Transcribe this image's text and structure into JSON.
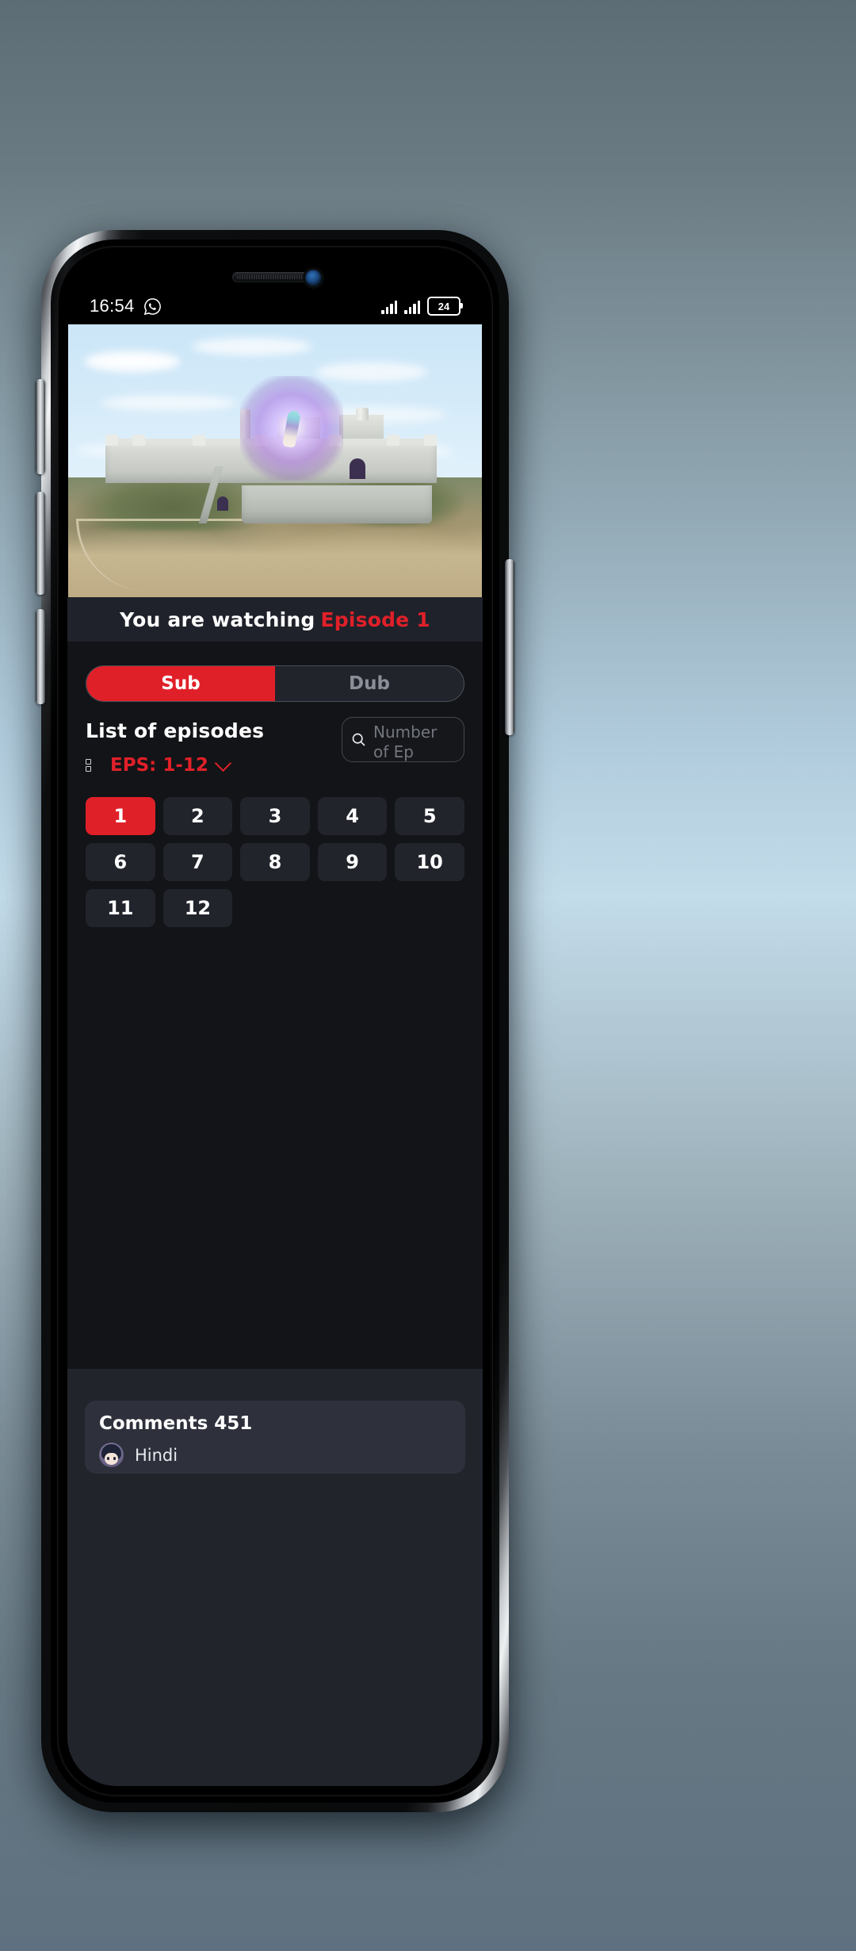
{
  "statusbar": {
    "time": "16:54",
    "whatsapp_icon": "whatsapp-icon",
    "signal_icon": "signal-bars-icon",
    "battery_level": "24"
  },
  "player": {
    "name": "video-player",
    "scene_description": "anime castle fortress on rocky hill with glowing purple aura"
  },
  "watching": {
    "prefix": "You are watching",
    "episode": "Episode 1",
    "accent_color": "#e02029"
  },
  "toggle": {
    "sub_label": "Sub",
    "dub_label": "Dub",
    "active": "Sub"
  },
  "episodes_header": {
    "title": "List of episodes",
    "range_label": "EPS: 1-12",
    "list_icon": "list-icon",
    "chevron_icon": "chevron-down-icon"
  },
  "search": {
    "placeholder": "Number of Ep",
    "value": "",
    "icon": "search-icon"
  },
  "episodes": {
    "items": [
      "1",
      "2",
      "3",
      "4",
      "5",
      "6",
      "7",
      "8",
      "9",
      "10",
      "11",
      "12"
    ],
    "selected": "1",
    "selected_color": "#e02029"
  },
  "comments": {
    "title": "Comments 451",
    "count": "451",
    "user": "Hindi",
    "avatar_icon": "avatar"
  },
  "colors": {
    "accent_red": "#e02029",
    "panel_dark": "#131417",
    "panel_light": "#22242c",
    "card": "#2e313c",
    "banner": "#20222b"
  }
}
